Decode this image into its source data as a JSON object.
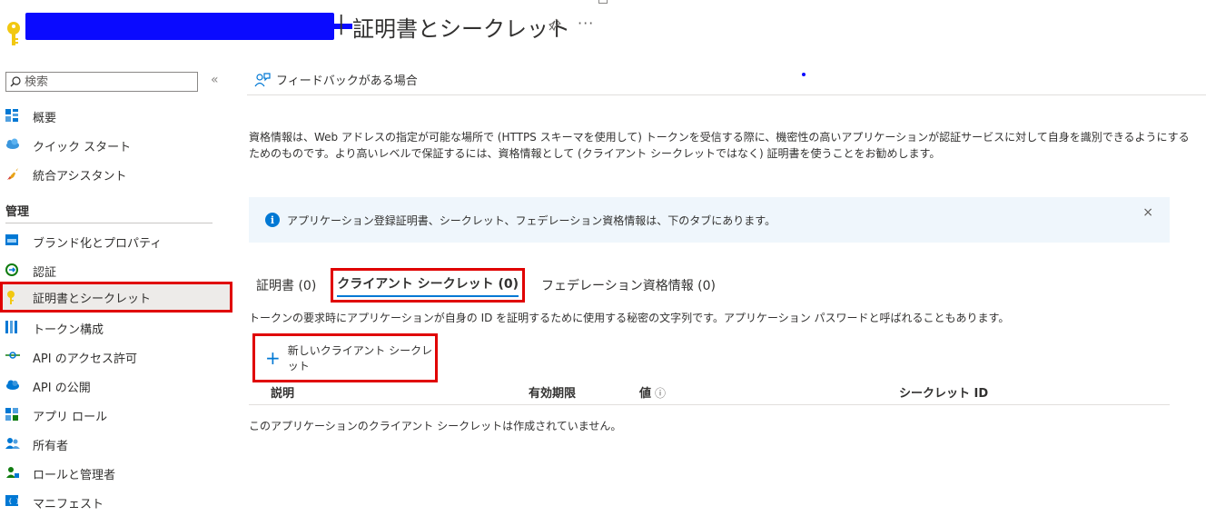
{
  "header": {
    "title": "証明書とシークレット",
    "separator": "|",
    "more": "···"
  },
  "sidebar": {
    "search_placeholder": "検索",
    "collapse": "«",
    "items_top": [
      {
        "label": "概要",
        "icon": "overview-icon"
      },
      {
        "label": "クイック スタート",
        "icon": "quickstart-icon"
      },
      {
        "label": "統合アシスタント",
        "icon": "integration-assistant-icon"
      }
    ],
    "section_label": "管理",
    "items_manage": [
      {
        "label": "ブランド化とプロパティ",
        "icon": "branding-icon"
      },
      {
        "label": "認証",
        "icon": "authentication-icon"
      },
      {
        "label": "証明書とシークレット",
        "icon": "key-icon",
        "selected": true
      },
      {
        "label": "トークン構成",
        "icon": "token-config-icon"
      },
      {
        "label": "API のアクセス許可",
        "icon": "api-permissions-icon"
      },
      {
        "label": "API の公開",
        "icon": "expose-api-icon"
      },
      {
        "label": "アプリ ロール",
        "icon": "app-roles-icon"
      },
      {
        "label": "所有者",
        "icon": "owners-icon"
      },
      {
        "label": "ロールと管理者",
        "icon": "roles-admins-icon"
      },
      {
        "label": "マニフェスト",
        "icon": "manifest-icon"
      }
    ]
  },
  "main": {
    "feedback_label": "フィードバックがある場合",
    "description": "資格情報は、Web アドレスの指定が可能な場所で (HTTPS スキーマを使用して) トークンを受信する際に、機密性の高いアプリケーションが認証サービスに対して自身を識別できるようにするためのものです。より高いレベルで保証するには、資格情報として (クライアント シークレットではなく) 証明書を使うことをお勧めします。",
    "info_message": "アプリケーション登録証明書、シークレット、フェデレーション資格情報は、下のタブにあります。",
    "info_close": "×",
    "tabs": [
      {
        "label": "証明書 (0)"
      },
      {
        "label": "クライアント シークレット (0)",
        "active": true
      },
      {
        "label": "フェデレーション資格情報 (0)"
      }
    ],
    "tab_description": "トークンの要求時にアプリケーションが自身の ID を証明するために使用する秘密の文字列です。アプリケーション パスワードと呼ばれることもあります。",
    "new_secret_label": "新しいクライアント シークレット",
    "table": {
      "columns": [
        "説明",
        "有効期限",
        "値",
        "シークレット ID"
      ],
      "value_info": "ⓘ",
      "empty_message": "このアプリケーションのクライアント シークレットは作成されていません。"
    }
  },
  "colors": {
    "accent": "#0078d4",
    "highlight": "#e00000",
    "redaction": "#0a0aff",
    "info_bg": "#eff6fc"
  }
}
